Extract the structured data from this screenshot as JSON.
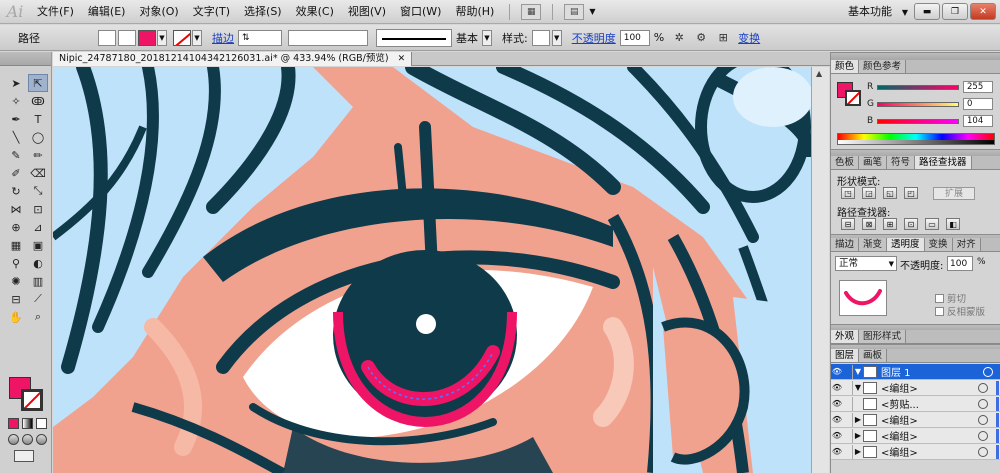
{
  "menubar": {
    "logo": "Ai",
    "items": [
      "文件(F)",
      "编辑(E)",
      "对象(O)",
      "文字(T)",
      "选择(S)",
      "效果(C)",
      "视图(V)",
      "窗口(W)",
      "帮助(H)"
    ],
    "workspace": "基本功能"
  },
  "controlbar": {
    "object_type": "路径",
    "stroke_link": "描边",
    "stroke_profile": "基本",
    "style_label": "样式:",
    "opacity_link": "不透明度",
    "opacity_value": "100",
    "opacity_unit": "%",
    "transform_link": "变换"
  },
  "document": {
    "tab_title": "Nipic_24787180_20181214104342126031.ai* @ 433.94% (RGB/预览)"
  },
  "colors": {
    "fill": "#ee1566",
    "skin": "#f1a28f",
    "dark": "#0f3a4a",
    "hair": "#bfe2fb"
  },
  "color_panel": {
    "tabs": [
      "颜色",
      "颜色参考"
    ],
    "r_label": "R",
    "r_value": "255",
    "g_label": "G",
    "g_value": "0",
    "b_label": "B",
    "b_value": "104"
  },
  "pathfinder_panel": {
    "tabs": [
      "色板",
      "画笔",
      "符号",
      "路径查找器"
    ],
    "shape_modes_label": "形状模式:",
    "expand_label": "扩展",
    "pathfinders_label": "路径查找器:"
  },
  "transparency_panel": {
    "tabs": [
      "描边",
      "渐变",
      "透明度",
      "变换",
      "对齐"
    ],
    "blend_mode": "正常",
    "opacity_label": "不透明度:",
    "opacity_value": "100",
    "opacity_unit": "%",
    "clip_label": "剪切",
    "invert_mask_label": "反相蒙版"
  },
  "appearance_panel": {
    "tabs": [
      "外观",
      "图形样式"
    ]
  },
  "layers_panel": {
    "tabs": [
      "图层",
      "画板"
    ],
    "rows": [
      {
        "name": "图层 1"
      },
      {
        "name": "<编组>"
      },
      {
        "name": "<剪贴..."
      },
      {
        "name": "<编组>"
      },
      {
        "name": "<编组>"
      },
      {
        "name": "<编组>"
      }
    ]
  }
}
